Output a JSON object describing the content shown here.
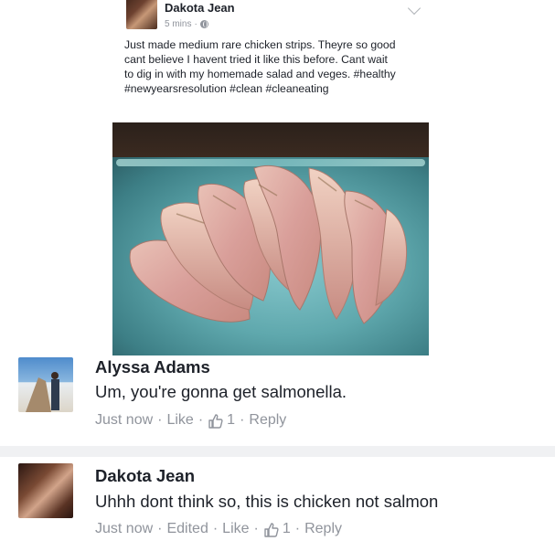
{
  "post": {
    "author": "Dakota Jean",
    "timestamp": "5 mins",
    "privacy_icon": "globe-icon",
    "menu_icon": "chevron-down-icon",
    "text": "Just made medium rare chicken strips. Theyre so good cant believe I havent tried it like this before. Cant wait to dig in with my homemade salad and veges. #healthy #newyearsresolution #clean #cleaneating"
  },
  "comments": [
    {
      "author": "Alyssa Adams",
      "text": "Um, you're gonna get salmonella.",
      "time": "Just now",
      "edited": "",
      "like_label": "Like",
      "like_icon": "thumbs-up-icon",
      "like_count": "1",
      "reply_label": "Reply"
    },
    {
      "author": "Dakota Jean",
      "text": "Uhhh dont think so, this is chicken not salmon",
      "time": "Just now",
      "edited": "Edited",
      "like_label": "Like",
      "like_icon": "thumbs-up-icon",
      "like_count": "1",
      "reply_label": "Reply"
    }
  ],
  "colors": {
    "text_primary": "#1d2129",
    "text_secondary": "#90949c",
    "divider": "#f0f1f3"
  },
  "separator": "·"
}
